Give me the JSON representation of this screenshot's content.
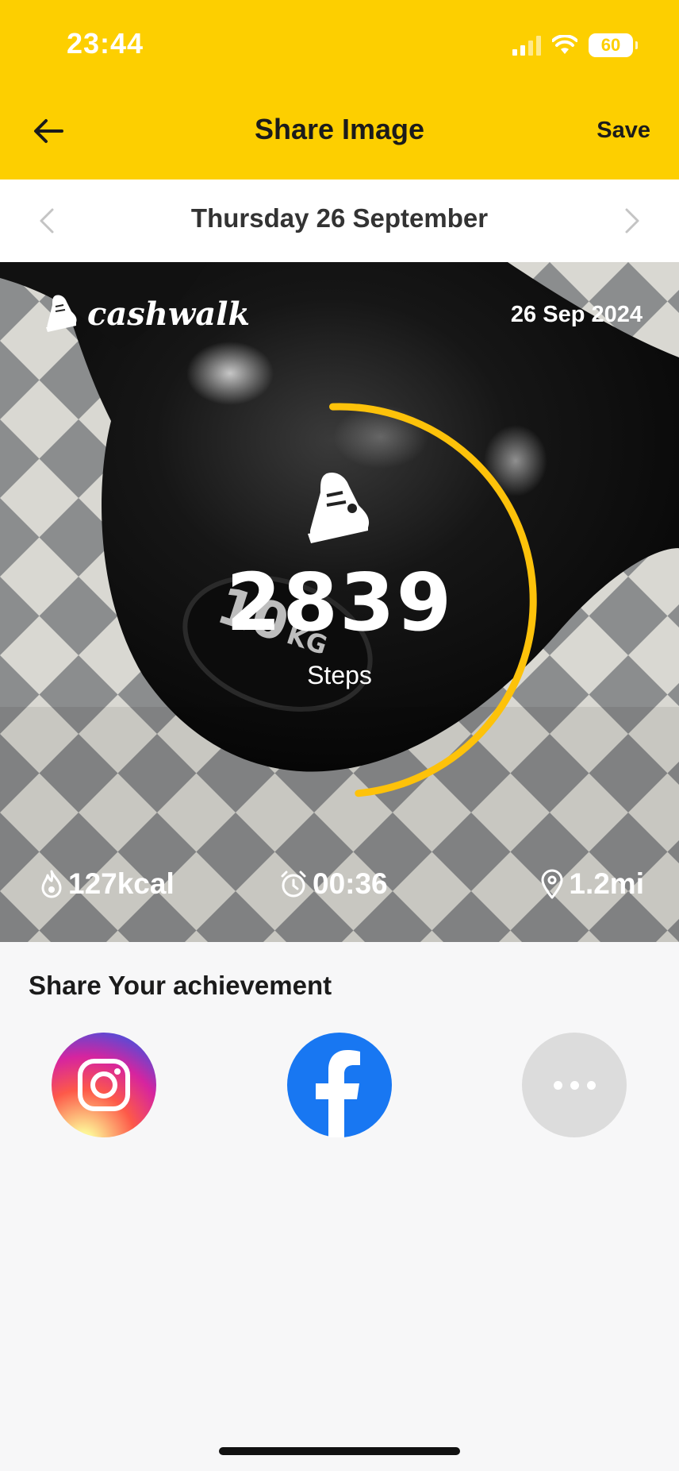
{
  "status_bar": {
    "time": "23:44",
    "battery": "60"
  },
  "nav": {
    "title": "Share Image",
    "save_label": "Save"
  },
  "date_nav": {
    "label": "Thursday 26 September"
  },
  "card": {
    "brand": "cashwalk",
    "date": "26 Sep 2024",
    "steps": "2839",
    "steps_label": "Steps",
    "progress_fraction": 0.5,
    "calories": "127kcal",
    "duration": "00:36",
    "distance": "1.2mi",
    "accent_color": "#fdc20a"
  },
  "share": {
    "title": "Share Your achievement",
    "options": [
      {
        "name": "instagram",
        "icon": "instagram-icon"
      },
      {
        "name": "facebook",
        "icon": "facebook-icon"
      },
      {
        "name": "more",
        "icon": "more-icon"
      }
    ]
  },
  "colors": {
    "header": "#fdcf00",
    "facebook": "#1877f2"
  }
}
